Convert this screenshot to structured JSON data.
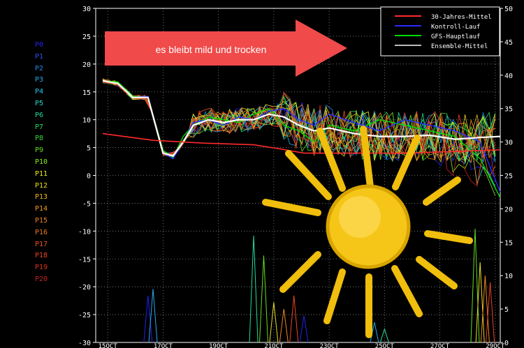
{
  "chart_data": {
    "type": "line",
    "y_left": {
      "min": -30,
      "max": 30,
      "ticks": [
        30,
        25,
        20,
        15,
        10,
        5,
        0,
        -5,
        -10,
        -15,
        -20,
        -25,
        -30
      ]
    },
    "y_right": {
      "min": 0,
      "max": 50,
      "ticks": [
        50,
        45,
        40,
        35,
        30,
        25,
        20,
        15,
        10,
        5,
        0
      ]
    },
    "x_ticks": [
      "15OCT",
      "17OCT",
      "19OCT",
      "21OCT",
      "23OCT",
      "25OCT",
      "27OCT",
      "29OCT"
    ],
    "grid": true,
    "legend_placement": "top-right",
    "legend": [
      {
        "label": "30-Jahres-Mittel",
        "color": "#ff2a2a"
      },
      {
        "label": "Kontroll-Lauf",
        "color": "#2a2aff"
      },
      {
        "label": "GFS-Hauptlauf",
        "color": "#00dd00"
      },
      {
        "label": "Ensemble-Mittel",
        "color": "#bbbbbb"
      }
    ],
    "members": [
      {
        "label": "P0",
        "color": "#2222ee"
      },
      {
        "label": "P1",
        "color": "#2255ee"
      },
      {
        "label": "P2",
        "color": "#2288ee"
      },
      {
        "label": "P3",
        "color": "#22aaee"
      },
      {
        "label": "P4",
        "color": "#22ccee"
      },
      {
        "label": "P5",
        "color": "#22ddcc"
      },
      {
        "label": "P6",
        "color": "#22dd99"
      },
      {
        "label": "P7",
        "color": "#22dd66"
      },
      {
        "label": "P8",
        "color": "#33dd33"
      },
      {
        "label": "P9",
        "color": "#66dd22"
      },
      {
        "label": "P10",
        "color": "#88ee22"
      },
      {
        "label": "P11",
        "color": "#eeee22"
      },
      {
        "label": "P12",
        "color": "#eedd22"
      },
      {
        "label": "P13",
        "color": "#eebb22"
      },
      {
        "label": "P14",
        "color": "#ee9922"
      },
      {
        "label": "P15",
        "color": "#ee8822"
      },
      {
        "label": "P16",
        "color": "#ee7722"
      },
      {
        "label": "P17",
        "color": "#ee5522"
      },
      {
        "label": "P18",
        "color": "#ee4422"
      },
      {
        "label": "P19",
        "color": "#dd3322"
      },
      {
        "label": "P20",
        "color": "#cc2222"
      }
    ],
    "series": {
      "ensemble_mean": [
        [
          0,
          17
        ],
        [
          0.3,
          16.5
        ],
        [
          0.6,
          14
        ],
        [
          0.9,
          14
        ],
        [
          1.2,
          4
        ],
        [
          1.4,
          3.5
        ],
        [
          1.6,
          6
        ],
        [
          1.8,
          9
        ],
        [
          2.1,
          10
        ],
        [
          2.4,
          9.5
        ],
        [
          2.7,
          10
        ],
        [
          3.0,
          10
        ],
        [
          3.3,
          11
        ],
        [
          3.6,
          10.5
        ],
        [
          3.9,
          9
        ],
        [
          4.2,
          8
        ],
        [
          4.5,
          8.5
        ],
        [
          5.0,
          7.5
        ],
        [
          5.5,
          7
        ],
        [
          6.0,
          7
        ],
        [
          6.5,
          7.2
        ],
        [
          7.0,
          6.5
        ],
        [
          7.5,
          6.8
        ],
        [
          7.9,
          7
        ]
      ],
      "mean_30y": [
        [
          0,
          7.5
        ],
        [
          1,
          6.3
        ],
        [
          2,
          5.8
        ],
        [
          3,
          5.5
        ],
        [
          3.5,
          4.8
        ],
        [
          4,
          4
        ],
        [
          5,
          4
        ],
        [
          6,
          4
        ],
        [
          7,
          4.3
        ],
        [
          7.9,
          4.6
        ]
      ],
      "control_run": [
        [
          0,
          17
        ],
        [
          0.3,
          16.5
        ],
        [
          0.6,
          14
        ],
        [
          0.9,
          14.2
        ],
        [
          1.2,
          4
        ],
        [
          1.4,
          3
        ],
        [
          1.6,
          6
        ],
        [
          1.8,
          9.5
        ],
        [
          2.1,
          10
        ],
        [
          2.4,
          9
        ],
        [
          2.7,
          10.5
        ],
        [
          3.0,
          10
        ],
        [
          3.3,
          11.5
        ],
        [
          3.6,
          12
        ],
        [
          3.9,
          10
        ],
        [
          4.2,
          9
        ],
        [
          4.5,
          11
        ],
        [
          5.0,
          9.5
        ],
        [
          5.5,
          8
        ],
        [
          6.0,
          10
        ],
        [
          6.5,
          9
        ],
        [
          7.0,
          8
        ],
        [
          7.5,
          6
        ],
        [
          7.9,
          -3
        ]
      ],
      "gfs_main": [
        [
          0,
          17
        ],
        [
          0.3,
          16.8
        ],
        [
          0.6,
          14.2
        ],
        [
          0.9,
          14
        ],
        [
          1.2,
          4.5
        ],
        [
          1.4,
          3.2
        ],
        [
          1.6,
          7
        ],
        [
          1.8,
          9
        ],
        [
          2.1,
          10.5
        ],
        [
          2.4,
          10
        ],
        [
          2.7,
          9.5
        ],
        [
          3.0,
          11
        ],
        [
          3.3,
          12
        ],
        [
          3.6,
          9
        ],
        [
          3.9,
          8
        ],
        [
          4.2,
          6
        ],
        [
          4.5,
          9
        ],
        [
          5.0,
          8
        ],
        [
          5.5,
          10
        ],
        [
          6.0,
          9
        ],
        [
          6.5,
          8
        ],
        [
          7.0,
          7
        ],
        [
          7.5,
          3
        ],
        [
          7.9,
          -4
        ]
      ]
    },
    "precip_series": {
      "note": "right axis, values on lower band",
      "spikes": [
        [
          0.9,
          7
        ],
        [
          1.0,
          8
        ],
        [
          3.0,
          16
        ],
        [
          3.2,
          13
        ],
        [
          3.4,
          6
        ],
        [
          3.6,
          5
        ],
        [
          3.8,
          7
        ],
        [
          4.0,
          4
        ],
        [
          5.4,
          3
        ],
        [
          5.6,
          2
        ],
        [
          7.4,
          17
        ],
        [
          7.5,
          12
        ],
        [
          7.6,
          10
        ],
        [
          7.7,
          9
        ]
      ]
    }
  },
  "banner": {
    "text": "es bleibt mild und trocken"
  },
  "colors": {
    "background": "#000000",
    "banner": "#f04a4a",
    "sun_body": "#f5c518",
    "sun_ray": "#f0be0c",
    "sun_outline": "#d8a400"
  }
}
